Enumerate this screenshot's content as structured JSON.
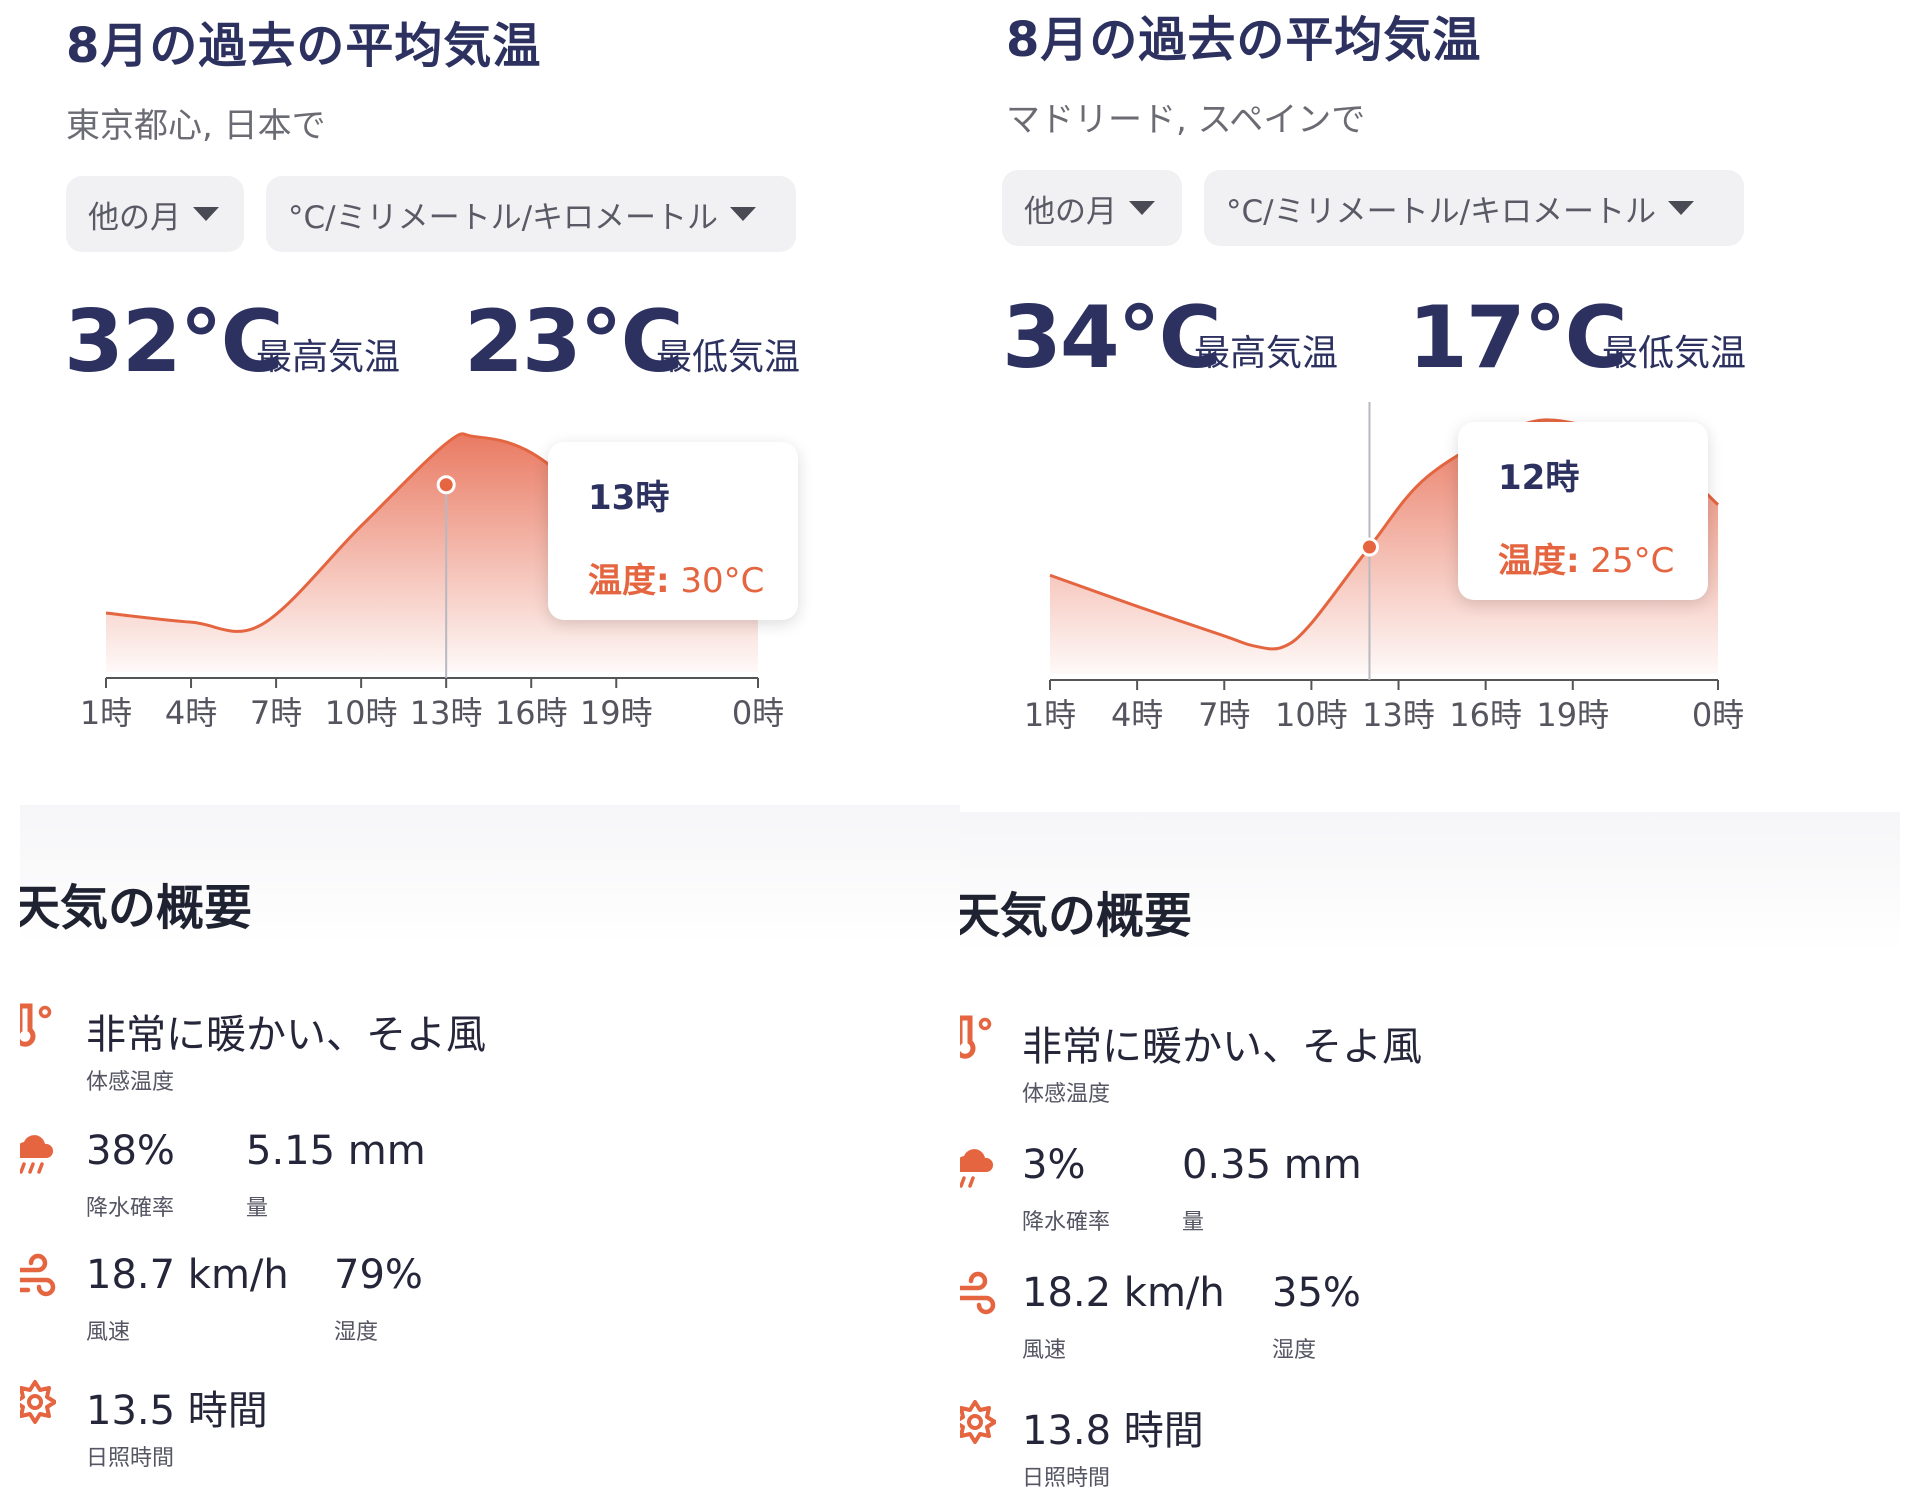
{
  "panels": [
    {
      "title": "8月の過去の平均気温",
      "location": "東京都心, 日本で",
      "month_button": "他の月",
      "unit_button": "°C/ミリメートル/キロメートル",
      "high_temp": "32°C",
      "high_label": "最高気温",
      "low_temp": "23°C",
      "low_label": "最低気温",
      "tooltip": {
        "hour": "13時",
        "temp_label": "温度:",
        "temp_value": "30°C"
      },
      "summary_title": "天気の概要",
      "feels_like": {
        "value": "非常に暖かい、そよ風",
        "label": "体感温度"
      },
      "precip_chance": {
        "value": "38%",
        "label": "降水確率"
      },
      "precip_amount": {
        "value": "5.15 mm",
        "label": "量"
      },
      "wind": {
        "value": "18.7 km/h",
        "label": "風速"
      },
      "humidity": {
        "value": "79%",
        "label": "湿度"
      },
      "sunshine": {
        "value": "13.5 時間",
        "label": "日照時間"
      }
    },
    {
      "title": "8月の過去の平均気温",
      "location": "マドリード, スペインで",
      "month_button": "他の月",
      "unit_button": "°C/ミリメートル/キロメートル",
      "high_temp": "34°C",
      "high_label": "最高気温",
      "low_temp": "17°C",
      "low_label": "最低気温",
      "tooltip": {
        "hour": "12時",
        "temp_label": "温度:",
        "temp_value": "25°C"
      },
      "summary_title": "天気の概要",
      "feels_like": {
        "value": "非常に暖かい、そよ風",
        "label": "体感温度"
      },
      "precip_chance": {
        "value": "3%",
        "label": "降水確率"
      },
      "precip_amount": {
        "value": "0.35 mm",
        "label": "量"
      },
      "wind": {
        "value": "18.2 km/h",
        "label": "風速"
      },
      "humidity": {
        "value": "35%",
        "label": "湿度"
      },
      "sunshine": {
        "value": "13.8 時間",
        "label": "日照時間"
      }
    }
  ],
  "colors": {
    "accent": "#e4653f",
    "title": "#2c3160",
    "area_top": "#e8735a"
  },
  "icons": [
    "thermometer-icon",
    "rain-cloud-icon",
    "wind-icon",
    "sun-icon",
    "caret-down-icon"
  ],
  "chart_data": [
    {
      "type": "area",
      "x_ticks": [
        "1時",
        "4時",
        "7時",
        "10時",
        "13時",
        "16時",
        "19時",
        "0時"
      ],
      "x_tick_hours": [
        1,
        4,
        7,
        10,
        13,
        16,
        19,
        24
      ],
      "x": [
        1,
        4,
        6.5,
        10,
        13,
        14,
        16,
        19,
        22,
        24
      ],
      "y": [
        24.4,
        24.0,
        23.9,
        28.2,
        31.8,
        32.1,
        31.4,
        28.6,
        26.5,
        24.7
      ],
      "ylim": [
        22,
        33
      ],
      "highlight": {
        "x": 13,
        "y": 30
      }
    },
    {
      "type": "area",
      "x_ticks": [
        "1時",
        "4時",
        "7時",
        "10時",
        "13時",
        "16時",
        "19時",
        "0時"
      ],
      "x_tick_hours": [
        1,
        4,
        7,
        10,
        13,
        16,
        19,
        24
      ],
      "x": [
        1,
        4,
        7,
        8,
        9,
        10,
        12,
        14,
        17,
        19,
        22,
        24
      ],
      "y": [
        23.0,
        20.8,
        18.7,
        18.0,
        17.9,
        19.6,
        25.0,
        30.0,
        33.5,
        33.8,
        31.6,
        28.0
      ],
      "ylim": [
        16,
        35
      ],
      "highlight": {
        "x": 12,
        "y": 25
      }
    }
  ]
}
